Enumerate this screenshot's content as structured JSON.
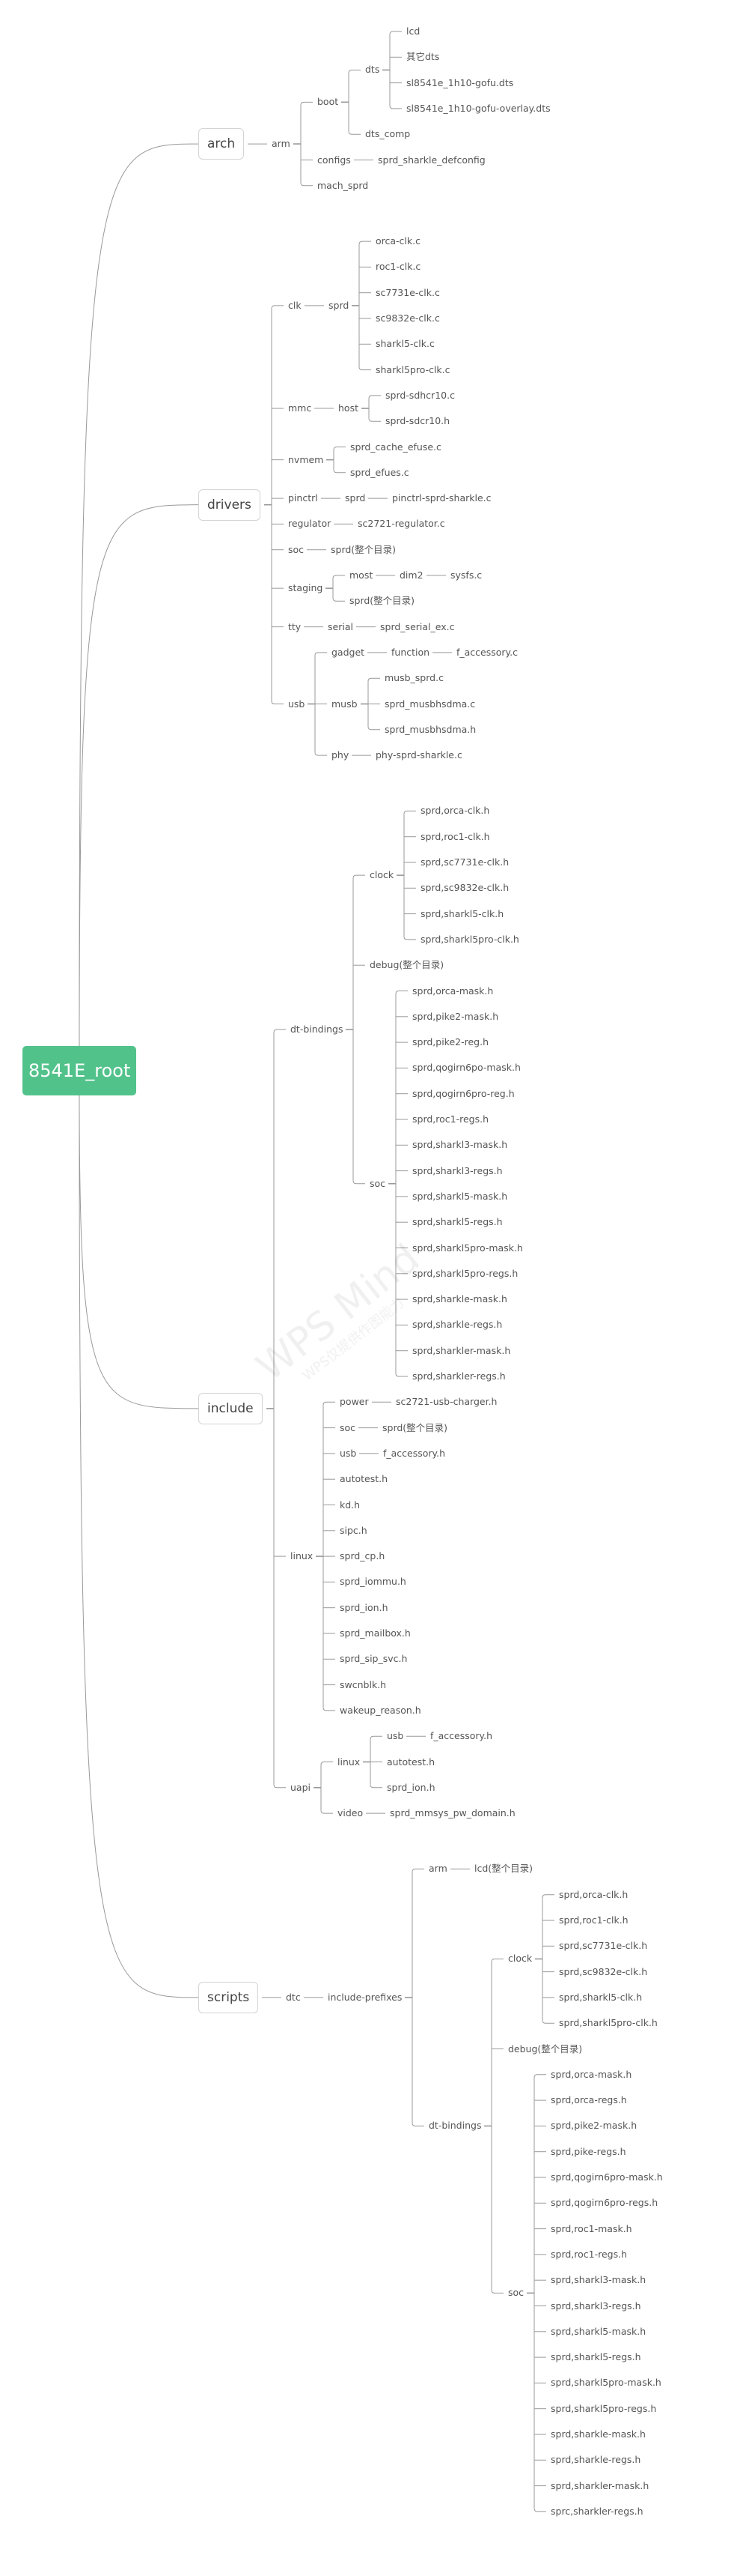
{
  "title": "8541E_root",
  "watermark": {
    "main": "WPS Mind",
    "sub": "WPS仅提供作图能力"
  },
  "colors": {
    "root": "#52c28b",
    "line": "#999999",
    "l1_border": "#d4d4d4"
  },
  "tree": {
    "label": "8541E_root",
    "children": [
      {
        "label": "arch",
        "children": [
          {
            "label": "arm",
            "children": [
              {
                "label": "boot",
                "children": [
                  {
                    "label": "dts",
                    "children": [
                      {
                        "label": "lcd"
                      },
                      {
                        "label": "其它dts"
                      },
                      {
                        "label": "sl8541e_1h10-gofu.dts"
                      },
                      {
                        "label": "sl8541e_1h10-gofu-overlay.dts"
                      }
                    ]
                  },
                  {
                    "label": "dts_comp"
                  }
                ]
              },
              {
                "label": "configs",
                "children": [
                  {
                    "label": "sprd_sharkle_defconfig"
                  }
                ]
              },
              {
                "label": "mach_sprd"
              }
            ]
          }
        ]
      },
      {
        "label": "drivers",
        "children": [
          {
            "label": "clk",
            "children": [
              {
                "label": "sprd",
                "children": [
                  {
                    "label": "orca-clk.c"
                  },
                  {
                    "label": "roc1-clk.c"
                  },
                  {
                    "label": "sc7731e-clk.c"
                  },
                  {
                    "label": "sc9832e-clk.c"
                  },
                  {
                    "label": "sharkl5-clk.c"
                  },
                  {
                    "label": "sharkl5pro-clk.c"
                  }
                ]
              }
            ]
          },
          {
            "label": "mmc",
            "children": [
              {
                "label": "host",
                "children": [
                  {
                    "label": "sprd-sdhcr10.c"
                  },
                  {
                    "label": "sprd-sdcr10.h"
                  }
                ]
              }
            ]
          },
          {
            "label": "nvmem",
            "children": [
              {
                "label": "sprd_cache_efuse.c"
              },
              {
                "label": "sprd_efues.c"
              }
            ]
          },
          {
            "label": "pinctrl",
            "children": [
              {
                "label": "sprd",
                "children": [
                  {
                    "label": "pinctrl-sprd-sharkle.c"
                  }
                ]
              }
            ]
          },
          {
            "label": "regulator",
            "children": [
              {
                "label": "sc2721-regulator.c"
              }
            ]
          },
          {
            "label": "soc",
            "children": [
              {
                "label": "sprd(整个目录)"
              }
            ]
          },
          {
            "label": "staging",
            "children": [
              {
                "label": "most",
                "children": [
                  {
                    "label": "dim2",
                    "children": [
                      {
                        "label": "sysfs.c"
                      }
                    ]
                  }
                ]
              },
              {
                "label": "sprd(整个目录)"
              }
            ]
          },
          {
            "label": "tty",
            "children": [
              {
                "label": "serial",
                "children": [
                  {
                    "label": "sprd_serial_ex.c"
                  }
                ]
              }
            ]
          },
          {
            "label": "usb",
            "children": [
              {
                "label": "gadget",
                "children": [
                  {
                    "label": "function",
                    "children": [
                      {
                        "label": "f_accessory.c"
                      }
                    ]
                  }
                ]
              },
              {
                "label": "musb",
                "children": [
                  {
                    "label": "musb_sprd.c"
                  },
                  {
                    "label": "sprd_musbhsdma.c"
                  },
                  {
                    "label": "sprd_musbhsdma.h"
                  }
                ]
              },
              {
                "label": "phy",
                "children": [
                  {
                    "label": "phy-sprd-sharkle.c"
                  }
                ]
              }
            ]
          }
        ]
      },
      {
        "label": "include",
        "children": [
          {
            "label": "dt-bindings",
            "children": [
              {
                "label": "clock",
                "children": [
                  {
                    "label": "sprd,orca-clk.h"
                  },
                  {
                    "label": "sprd,roc1-clk.h"
                  },
                  {
                    "label": "sprd,sc7731e-clk.h"
                  },
                  {
                    "label": "sprd,sc9832e-clk.h"
                  },
                  {
                    "label": "sprd,sharkl5-clk.h"
                  },
                  {
                    "label": "sprd,sharkl5pro-clk.h"
                  }
                ]
              },
              {
                "label": "debug(整个目录)"
              },
              {
                "label": "soc",
                "children": [
                  {
                    "label": "sprd,orca-mask.h"
                  },
                  {
                    "label": "sprd,pike2-mask.h"
                  },
                  {
                    "label": "sprd,pike2-reg.h"
                  },
                  {
                    "label": "sprd,qogirn6po-mask.h"
                  },
                  {
                    "label": "sprd,qogirn6pro-reg.h"
                  },
                  {
                    "label": "sprd,roc1-regs.h"
                  },
                  {
                    "label": "sprd,sharkl3-mask.h"
                  },
                  {
                    "label": "sprd,sharkl3-regs.h"
                  },
                  {
                    "label": "sprd,sharkl5-mask.h"
                  },
                  {
                    "label": "sprd,sharkl5-regs.h"
                  },
                  {
                    "label": "sprd,sharkl5pro-mask.h"
                  },
                  {
                    "label": "sprd,sharkl5pro-regs.h"
                  },
                  {
                    "label": "sprd,sharkle-mask.h"
                  },
                  {
                    "label": "sprd,sharkle-regs.h"
                  },
                  {
                    "label": "sprd,sharkler-mask.h"
                  },
                  {
                    "label": "sprd,sharkler-regs.h"
                  }
                ]
              }
            ]
          },
          {
            "label": "linux",
            "children": [
              {
                "label": "power",
                "children": [
                  {
                    "label": "sc2721-usb-charger.h"
                  }
                ]
              },
              {
                "label": "soc",
                "children": [
                  {
                    "label": "sprd(整个目录)"
                  }
                ]
              },
              {
                "label": "usb",
                "children": [
                  {
                    "label": "f_accessory.h"
                  }
                ]
              },
              {
                "label": "autotest.h"
              },
              {
                "label": "kd.h"
              },
              {
                "label": "sipc.h"
              },
              {
                "label": "sprd_cp.h"
              },
              {
                "label": "sprd_iommu.h"
              },
              {
                "label": "sprd_ion.h"
              },
              {
                "label": "sprd_mailbox.h"
              },
              {
                "label": "sprd_sip_svc.h"
              },
              {
                "label": "swcnblk.h"
              },
              {
                "label": "wakeup_reason.h"
              }
            ]
          },
          {
            "label": "uapi",
            "children": [
              {
                "label": "linux",
                "children": [
                  {
                    "label": "usb",
                    "children": [
                      {
                        "label": "f_accessory.h"
                      }
                    ]
                  },
                  {
                    "label": "autotest.h"
                  },
                  {
                    "label": "sprd_ion.h"
                  }
                ]
              },
              {
                "label": "video",
                "children": [
                  {
                    "label": "sprd_mmsys_pw_domain.h"
                  }
                ]
              }
            ]
          }
        ]
      },
      {
        "label": "scripts",
        "children": [
          {
            "label": "dtc",
            "children": [
              {
                "label": "include-prefixes",
                "children": [
                  {
                    "label": "arm",
                    "children": [
                      {
                        "label": "lcd(整个目录)"
                      }
                    ]
                  },
                  {
                    "label": "dt-bindings",
                    "children": [
                      {
                        "label": "clock",
                        "children": [
                          {
                            "label": "sprd,orca-clk.h"
                          },
                          {
                            "label": "sprd,roc1-clk.h"
                          },
                          {
                            "label": "sprd,sc7731e-clk.h"
                          },
                          {
                            "label": "sprd,sc9832e-clk.h"
                          },
                          {
                            "label": "sprd,sharkl5-clk.h"
                          },
                          {
                            "label": "sprd,sharkl5pro-clk.h"
                          }
                        ]
                      },
                      {
                        "label": "debug(整个目录)"
                      },
                      {
                        "label": "soc",
                        "children": [
                          {
                            "label": "sprd,orca-mask.h"
                          },
                          {
                            "label": "sprd,orca-regs.h"
                          },
                          {
                            "label": "sprd,pike2-mask.h"
                          },
                          {
                            "label": "sprd,pike-regs.h"
                          },
                          {
                            "label": "sprd,qogirn6pro-mask.h"
                          },
                          {
                            "label": "sprd,qogirn6pro-regs.h"
                          },
                          {
                            "label": "sprd,roc1-mask.h"
                          },
                          {
                            "label": "sprd,roc1-regs.h"
                          },
                          {
                            "label": "sprd,sharkl3-mask.h"
                          },
                          {
                            "label": "sprd,sharkl3-regs.h"
                          },
                          {
                            "label": "sprd,sharkl5-mask.h"
                          },
                          {
                            "label": "sprd,sharkl5-regs.h"
                          },
                          {
                            "label": "sprd,sharkl5pro-mask.h"
                          },
                          {
                            "label": "sprd,sharkl5pro-regs.h"
                          },
                          {
                            "label": "sprd,sharkle-mask.h"
                          },
                          {
                            "label": "sprd,sharkle-regs.h"
                          },
                          {
                            "label": "sprd,sharkler-mask.h"
                          },
                          {
                            "label": "sprc,sharkler-regs.h"
                          }
                        ]
                      }
                    ]
                  }
                ]
              }
            ]
          }
        ]
      }
    ]
  }
}
